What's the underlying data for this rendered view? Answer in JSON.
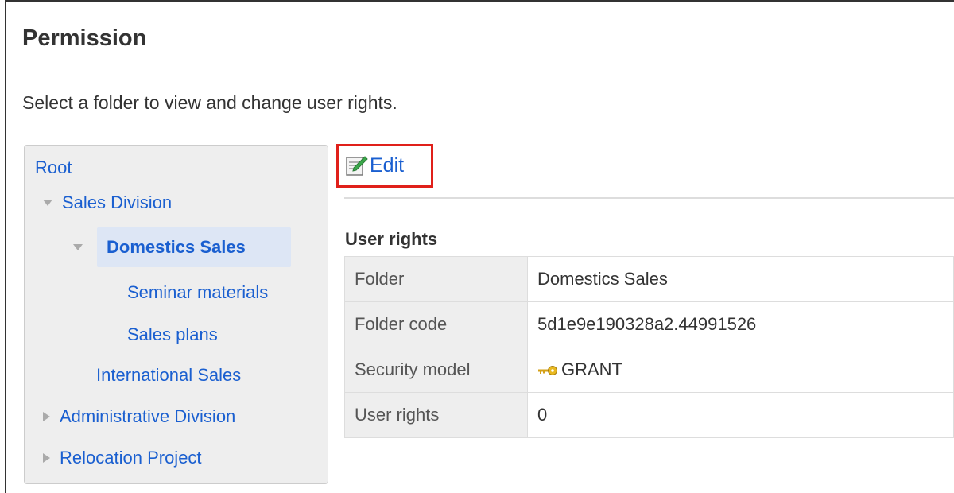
{
  "page": {
    "title": "Permission",
    "instructions": "Select a folder to view and change user rights."
  },
  "tree": {
    "root": "Root",
    "items": [
      {
        "label": "Sales Division",
        "state": "expanded"
      },
      {
        "label": "Domestics Sales",
        "state": "expanded",
        "selected": true
      },
      {
        "label": "Seminar materials",
        "state": "leaf"
      },
      {
        "label": "Sales plans",
        "state": "leaf"
      },
      {
        "label": "International Sales",
        "state": "leaf"
      },
      {
        "label": "Administrative Division",
        "state": "collapsed"
      },
      {
        "label": "Relocation Project",
        "state": "collapsed"
      }
    ]
  },
  "toolbar": {
    "edit_label": "Edit",
    "edit_icon": "edit-icon"
  },
  "rights": {
    "heading": "User rights",
    "rows": [
      {
        "label": "Folder",
        "value": "Domestics Sales"
      },
      {
        "label": "Folder code",
        "value": "5d1e9e190328a2.44991526"
      },
      {
        "label": "Security model",
        "value": "GRANT",
        "icon": "key-icon"
      },
      {
        "label": "User rights",
        "value": "0"
      }
    ]
  },
  "colors": {
    "link": "#1a5fd0",
    "highlight_border": "#e0201a",
    "selected_bg": "#dde6f5",
    "panel_bg": "#eeeeee"
  }
}
